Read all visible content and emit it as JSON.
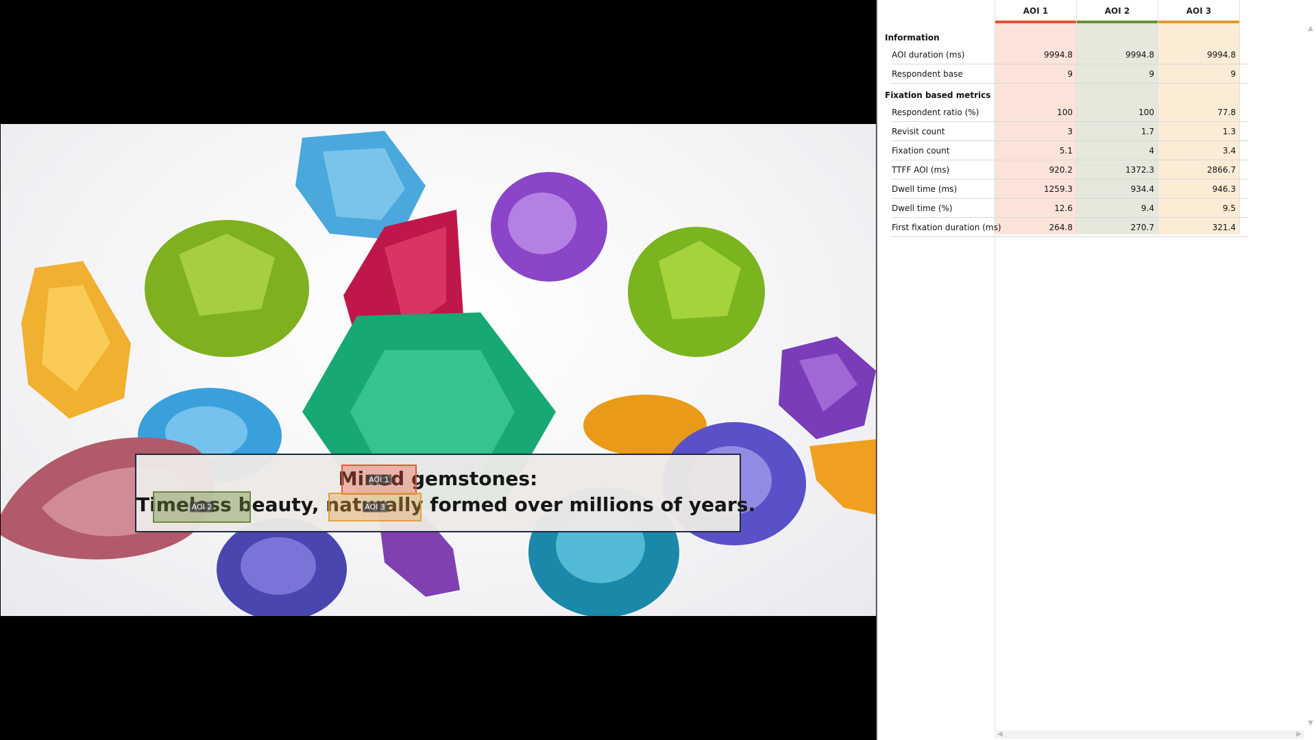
{
  "stimulus": {
    "caption_line1": "Mined gemstones:",
    "caption_line2": "Timeless beauty, naturally formed over millions of years.",
    "aois": [
      {
        "label": "AOI 1",
        "color": "#e8553a"
      },
      {
        "label": "AOI 2",
        "color": "#6e8a3a"
      },
      {
        "label": "AOI 3",
        "color": "#e0a040"
      }
    ]
  },
  "panel": {
    "columns": [
      {
        "label": "AOI 1",
        "bar_color": "#e2532f",
        "bg": "#fbe3da"
      },
      {
        "label": "AOI 2",
        "bar_color": "#6b8f35",
        "bg": "#e6e8dc"
      },
      {
        "label": "AOI 3",
        "bar_color": "#e09a2c",
        "bg": "#fbecd6"
      }
    ],
    "sections": [
      {
        "title": "Information",
        "rows": [
          {
            "label": "AOI duration (ms)",
            "values": [
              "9994.8",
              "9994.8",
              "9994.8"
            ]
          },
          {
            "label": "Respondent base",
            "values": [
              "9",
              "9",
              "9"
            ]
          }
        ]
      },
      {
        "title": "Fixation based metrics",
        "rows": [
          {
            "label": "Respondent ratio (%)",
            "values": [
              "100",
              "100",
              "77.8"
            ]
          },
          {
            "label": "Revisit count",
            "values": [
              "3",
              "1.7",
              "1.3"
            ]
          },
          {
            "label": "Fixation count",
            "values": [
              "5.1",
              "4",
              "3.4"
            ]
          },
          {
            "label": "TTFF AOI (ms)",
            "values": [
              "920.2",
              "1372.3",
              "2866.7"
            ]
          },
          {
            "label": "Dwell time (ms)",
            "values": [
              "1259.3",
              "934.4",
              "946.3"
            ]
          },
          {
            "label": "Dwell time (%)",
            "values": [
              "12.6",
              "9.4",
              "9.5"
            ]
          },
          {
            "label": "First fixation duration (ms)",
            "values": [
              "264.8",
              "270.7",
              "321.4"
            ]
          }
        ]
      }
    ]
  }
}
